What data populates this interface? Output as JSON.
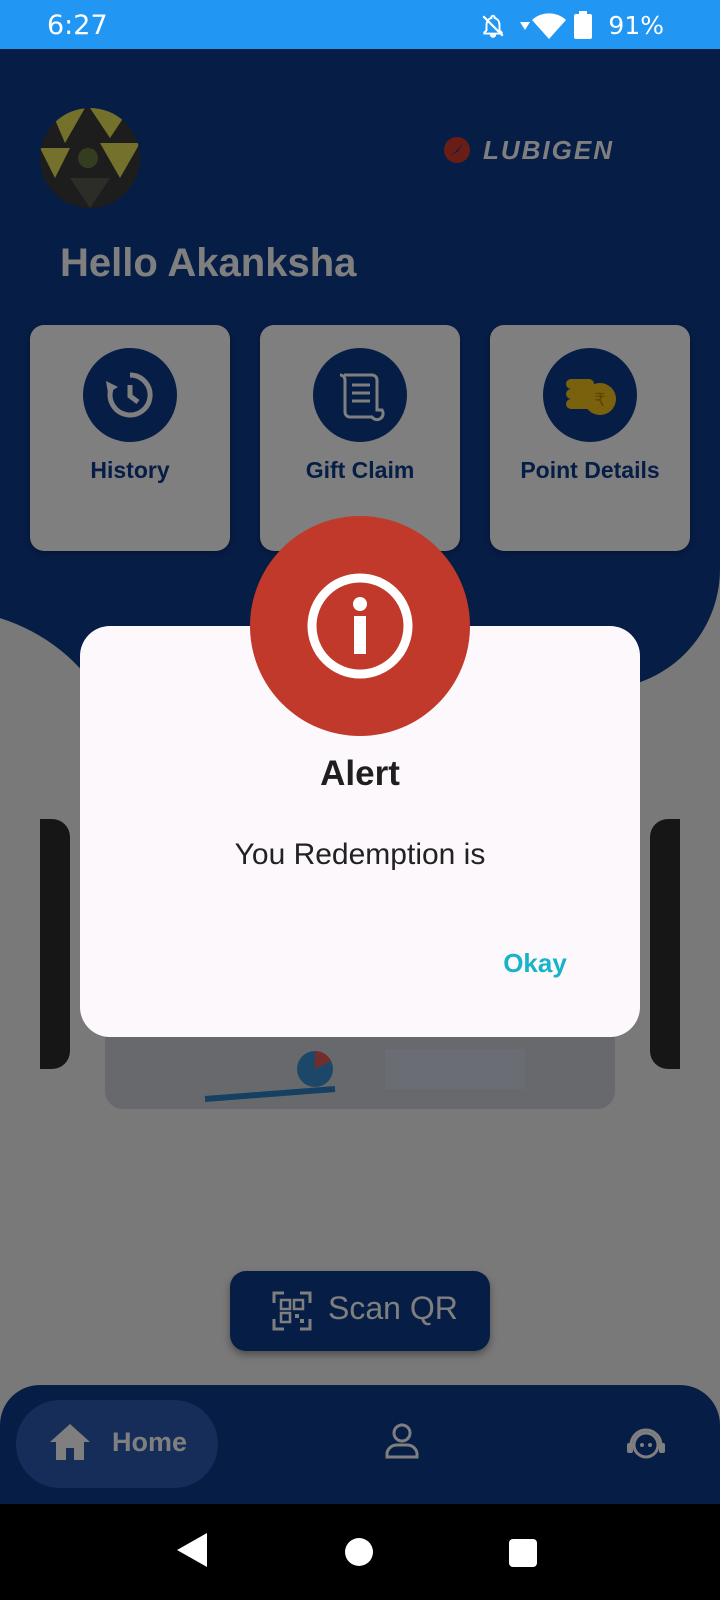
{
  "status_bar": {
    "time": "6:27",
    "battery": "91%"
  },
  "header": {
    "brand": "LUBIGEN",
    "greeting": "Hello Akanksha"
  },
  "cards": [
    {
      "label": "History",
      "icon": "history-icon"
    },
    {
      "label": "Gift Claim",
      "icon": "scroll-icon"
    },
    {
      "label": "Point Details",
      "icon": "coins-rupee-icon"
    }
  ],
  "scan": {
    "label": "Scan QR",
    "icon": "qr-code-icon"
  },
  "bottom_nav": {
    "home_label": "Home",
    "items": [
      "home-icon",
      "profile-icon",
      "support-icon"
    ]
  },
  "dialog": {
    "title": "Alert",
    "message": "You Redemption is",
    "ok_label": "Okay",
    "icon": "info-icon"
  },
  "colors": {
    "primary": "#0d3a8c",
    "alert": "#c0392b",
    "accent": "#17b3c9",
    "status_bar": "#2196f3"
  }
}
